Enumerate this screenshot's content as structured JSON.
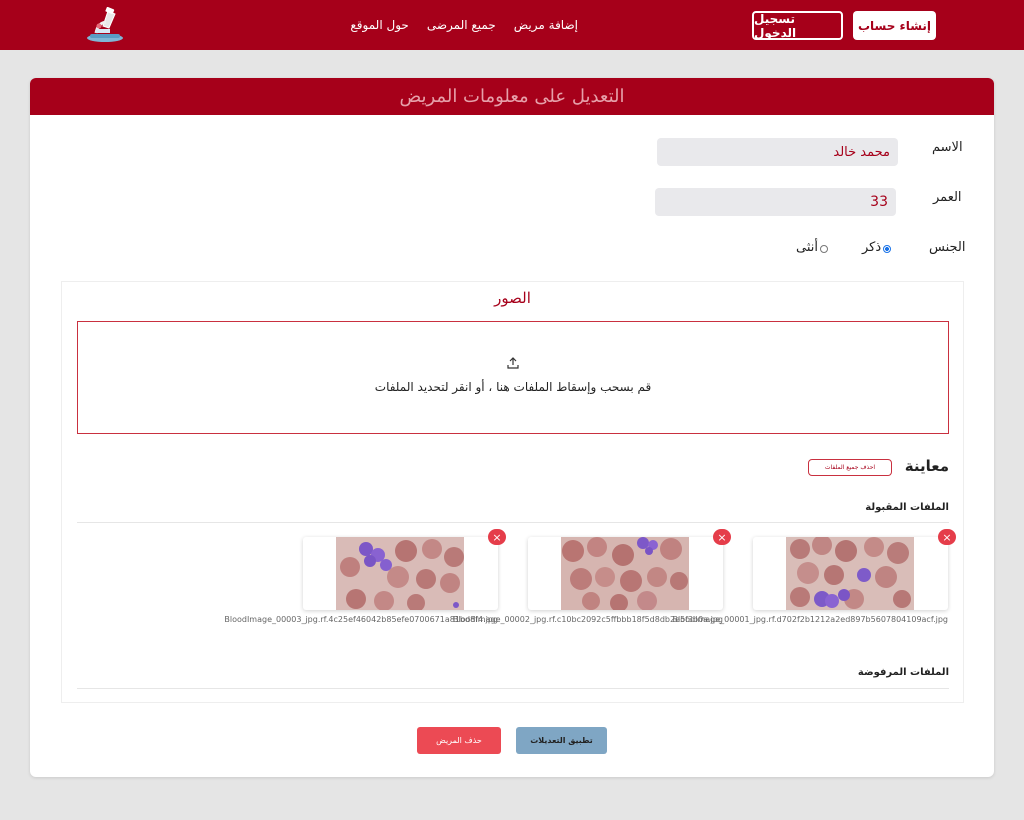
{
  "nav": {
    "links": [
      "إضافة مريض",
      "جميع المرضى",
      "حول الموقع"
    ],
    "login": "تسجيل الدخول",
    "signup": "إنشاء حساب"
  },
  "form": {
    "title": "التعديل على معلومات المريض",
    "name_label": "الاسم",
    "name_value": "محمد خالد",
    "age_label": "العمر",
    "age_value": "33",
    "gender_label": "الجنس",
    "gender_male": "ذكر",
    "gender_female": "أنثى",
    "gender_selected": "ذكر"
  },
  "images": {
    "title": "الصور",
    "dropzone_text": "قم بسحب وإسقاط الملفات هنا ، أو انقر لتحديد الملفات",
    "preview_title": "معاينة",
    "delete_all": "احذف جميع الملفات",
    "accepted_label": "الملفات المقبولة",
    "rejected_label": "الملفات المرفوضة",
    "files": [
      "BloodImage_00001_jpg.rf.d702f2b1212a2ed897b5607804109acf.jpg",
      "BloodImage_00002_jpg.rf.c10bc2092c5ffbbb18f5d8db2e5f3b0a.jpg",
      "BloodImage_00003_jpg.rf.4c25ef46042b85efe0700671a81bd8f4.jpg"
    ]
  },
  "actions": {
    "apply": "تطبيق التعديلات",
    "delete_patient": "حذف المريض"
  },
  "colors": {
    "brand": "#a6001a",
    "apply_button": "#7fa6c4",
    "delete_button": "#ec4a54"
  },
  "icons": [
    "microscope-logo",
    "upload-icon",
    "close-icon"
  ]
}
